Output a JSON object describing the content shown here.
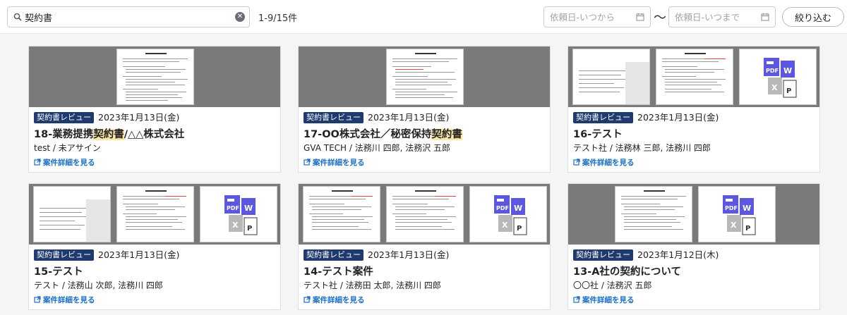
{
  "search": {
    "value": "契約書",
    "placeholder": ""
  },
  "result_count": "1-9/15件",
  "date_from_placeholder": "依頼日-いつから",
  "date_to_placeholder": "依頼日-いつまで",
  "date_separator": "〜",
  "filter_button": "絞り込む",
  "icons": {
    "search": "search-icon",
    "clear": "clear-icon",
    "calendar": "calendar-icon",
    "external_link": "external-link-icon"
  },
  "colors": {
    "badge": "#1f3a6e",
    "link": "#1a6fc9",
    "highlight": "#fbe7a6"
  },
  "cards": [
    {
      "badge": "契約書レビュー",
      "date": "2023年1月13日(金)",
      "title_pre": "18-業務提携",
      "title_hl": "契約書",
      "title_post": "/△△株式会社",
      "people": "test / 未アサイン",
      "link": "案件詳細を見る"
    },
    {
      "badge": "契約書レビュー",
      "date": "2023年1月13日(金)",
      "title_pre": "17-OO株式会社／秘密保持",
      "title_hl": "契約書",
      "title_post": "",
      "people": "GVA TECH / 法務川 四郎, 法務沢 五郎",
      "link": "案件詳細を見る"
    },
    {
      "badge": "契約書レビュー",
      "date": "2023年1月13日(金)",
      "title_pre": "16-テスト",
      "title_hl": "",
      "title_post": "",
      "people": "テスト社 / 法務林 三郎, 法務川 四郎",
      "link": "案件詳細を見る"
    },
    {
      "badge": "契約書レビュー",
      "date": "2023年1月13日(金)",
      "title_pre": "15-テスト",
      "title_hl": "",
      "title_post": "",
      "people": "テスト / 法務山 次郎, 法務川 四郎",
      "link": "案件詳細を見る"
    },
    {
      "badge": "契約書レビュー",
      "date": "2023年1月13日(金)",
      "title_pre": "14-テスト案件",
      "title_hl": "",
      "title_post": "",
      "people": "テスト社 / 法務田 太郎, 法務川 四郎",
      "link": "案件詳細を見る"
    },
    {
      "badge": "契約書レビュー",
      "date": "2023年1月12日(木)",
      "title_pre": "13-A社の契約について",
      "title_hl": "",
      "title_post": "",
      "people": "〇〇社 / 法務沢 五郎",
      "link": "案件詳細を見る"
    }
  ]
}
